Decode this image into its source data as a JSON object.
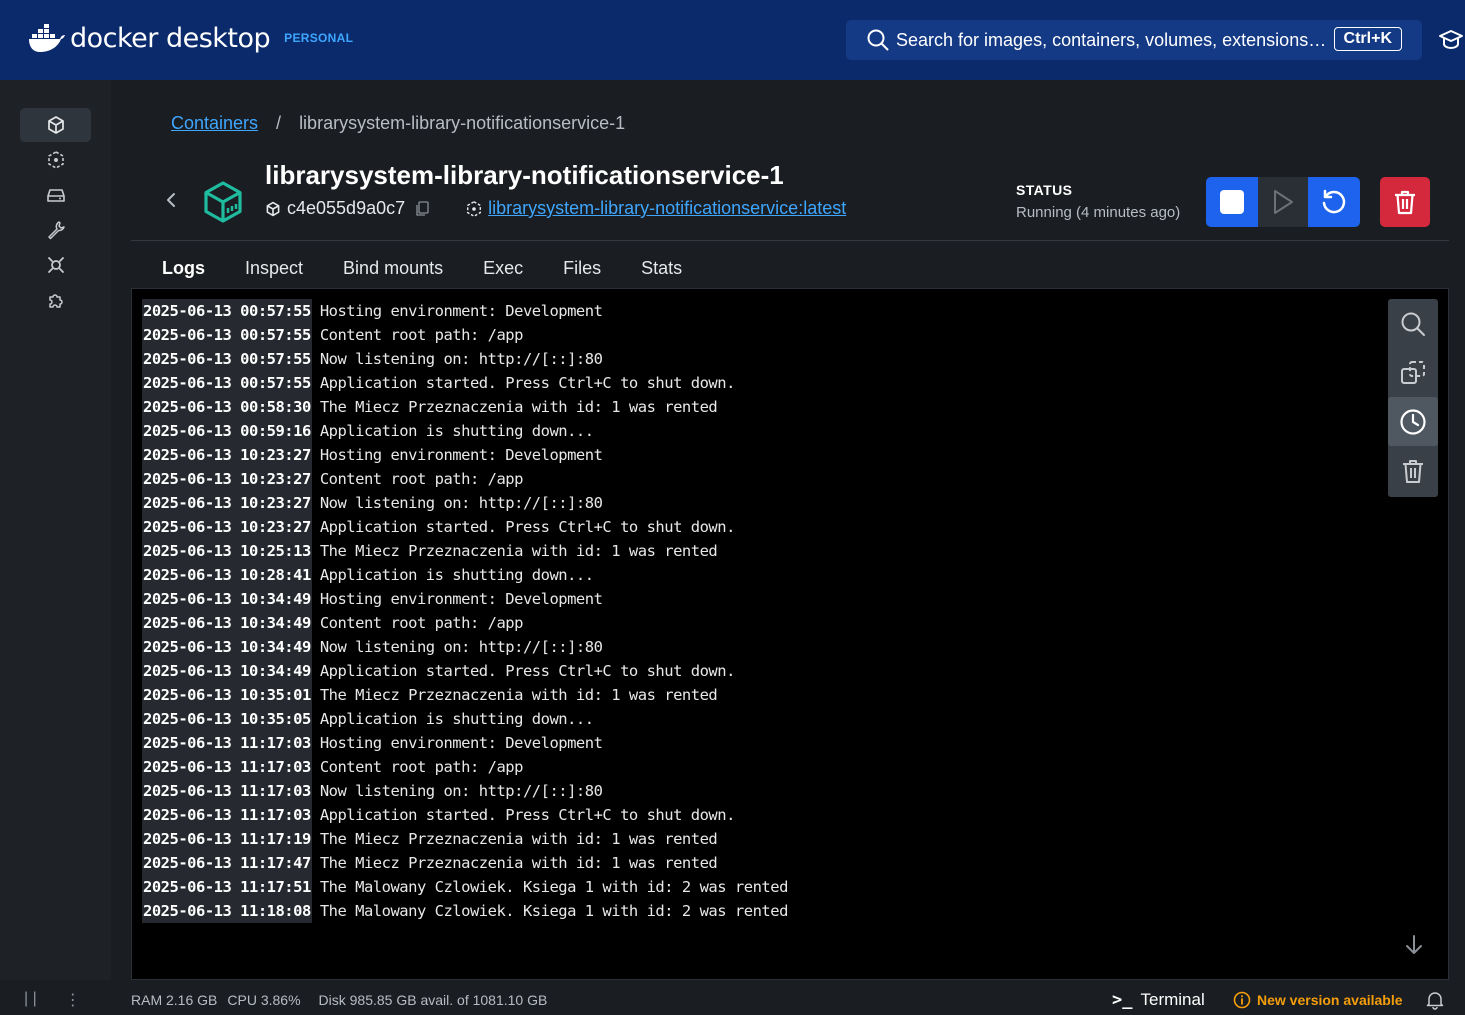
{
  "app": {
    "brand": "docker desktop",
    "plan": "PERSONAL",
    "search_placeholder": "Search for images, containers, volumes, extensions…",
    "search_shortcut": "Ctrl+K"
  },
  "sidebar": {
    "items": [
      {
        "name": "containers",
        "icon": "cube-icon",
        "active": true
      },
      {
        "name": "images",
        "icon": "image-layers-icon",
        "active": false
      },
      {
        "name": "volumes",
        "icon": "drive-icon",
        "active": false
      },
      {
        "name": "builds",
        "icon": "wrench-icon",
        "active": false
      },
      {
        "name": "docker-scout",
        "icon": "scout-icon",
        "active": false
      },
      {
        "name": "extensions",
        "icon": "puzzle-icon",
        "active": false
      }
    ]
  },
  "breadcrumb": {
    "root": "Containers",
    "separator": "/",
    "current": "librarysystem-library-notificationservice-1"
  },
  "container": {
    "name": "librarysystem-library-notificationservice-1",
    "id": "c4e055d9a0c7",
    "image": "librarysystem-library-notificationservice:latest",
    "status_label": "STATUS",
    "status_value": "Running (4 minutes ago)"
  },
  "tabs": [
    "Logs",
    "Inspect",
    "Bind mounts",
    "Exec",
    "Files",
    "Stats"
  ],
  "active_tab": "Logs",
  "logs": [
    {
      "ts": "2025-06-13 00:57:55",
      "msg": "Hosting environment: Development"
    },
    {
      "ts": "2025-06-13 00:57:55",
      "msg": "Content root path: /app"
    },
    {
      "ts": "2025-06-13 00:57:55",
      "msg": "Now listening on: http://[::]:80"
    },
    {
      "ts": "2025-06-13 00:57:55",
      "msg": "Application started. Press Ctrl+C to shut down."
    },
    {
      "ts": "2025-06-13 00:58:30",
      "msg": "The Miecz Przeznaczenia with id: 1 was rented"
    },
    {
      "ts": "2025-06-13 00:59:16",
      "msg": "Application is shutting down..."
    },
    {
      "ts": "2025-06-13 10:23:27",
      "msg": "Hosting environment: Development"
    },
    {
      "ts": "2025-06-13 10:23:27",
      "msg": "Content root path: /app"
    },
    {
      "ts": "2025-06-13 10:23:27",
      "msg": "Now listening on: http://[::]:80"
    },
    {
      "ts": "2025-06-13 10:23:27",
      "msg": "Application started. Press Ctrl+C to shut down."
    },
    {
      "ts": "2025-06-13 10:25:13",
      "msg": "The Miecz Przeznaczenia with id: 1 was rented"
    },
    {
      "ts": "2025-06-13 10:28:41",
      "msg": "Application is shutting down..."
    },
    {
      "ts": "2025-06-13 10:34:49",
      "msg": "Hosting environment: Development"
    },
    {
      "ts": "2025-06-13 10:34:49",
      "msg": "Content root path: /app"
    },
    {
      "ts": "2025-06-13 10:34:49",
      "msg": "Now listening on: http://[::]:80"
    },
    {
      "ts": "2025-06-13 10:34:49",
      "msg": "Application started. Press Ctrl+C to shut down."
    },
    {
      "ts": "2025-06-13 10:35:01",
      "msg": "The Miecz Przeznaczenia with id: 1 was rented"
    },
    {
      "ts": "2025-06-13 10:35:05",
      "msg": "Application is shutting down..."
    },
    {
      "ts": "2025-06-13 11:17:03",
      "msg": "Hosting environment: Development"
    },
    {
      "ts": "2025-06-13 11:17:03",
      "msg": "Content root path: /app"
    },
    {
      "ts": "2025-06-13 11:17:03",
      "msg": "Now listening on: http://[::]:80"
    },
    {
      "ts": "2025-06-13 11:17:03",
      "msg": "Application started. Press Ctrl+C to shut down."
    },
    {
      "ts": "2025-06-13 11:17:19",
      "msg": "The Miecz Przeznaczenia with id: 1 was rented"
    },
    {
      "ts": "2025-06-13 11:17:47",
      "msg": "The Miecz Przeznaczenia with id: 1 was rented"
    },
    {
      "ts": "2025-06-13 11:17:51",
      "msg": "The Malowany Czlowiek. Ksiega 1 with id: 2 was rented"
    },
    {
      "ts": "2025-06-13 11:18:08",
      "msg": "The Malowany Czlowiek. Ksiega 1 with id: 2 was rented"
    }
  ],
  "footer": {
    "ram": "RAM 2.16 GB",
    "cpu": "CPU 3.86%",
    "disk": "Disk 985.85 GB avail. of 1081.10 GB",
    "terminal": "Terminal",
    "new_version": "New version available"
  },
  "colors": {
    "header_bg": "#0b2a6b",
    "accent": "#1d63ed",
    "link": "#3ea6ff",
    "danger": "#d4283c",
    "container_icon": "#1fbca0",
    "warning": "#f59e0b"
  }
}
